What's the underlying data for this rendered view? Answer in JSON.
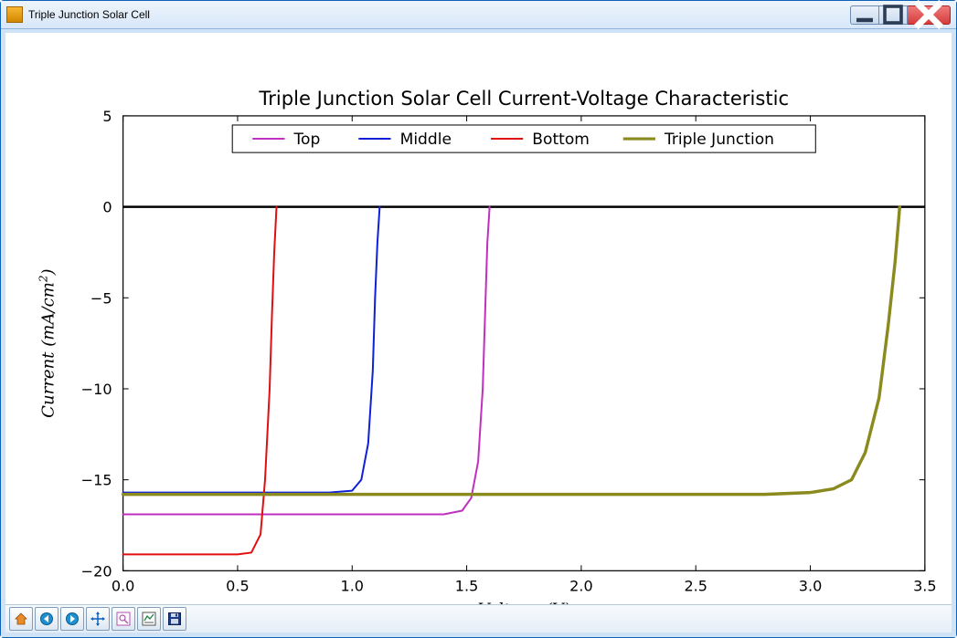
{
  "window": {
    "title": "Triple Junction Solar Cell"
  },
  "toolbar": {
    "home": "Home",
    "back": "Back",
    "forward": "Forward",
    "pan": "Pan",
    "zoom": "Zoom",
    "subplots": "Subplots",
    "save": "Save"
  },
  "chart_data": {
    "type": "line",
    "title": "Triple Junction Solar Cell Current-Voltage Characteristic",
    "xlabel": "Voltage (V)",
    "ylabel": "Current (mA/cm²)",
    "xlim": [
      0.0,
      3.5
    ],
    "ylim": [
      -20,
      5
    ],
    "xticks": [
      0.0,
      0.5,
      1.0,
      1.5,
      2.0,
      2.5,
      3.0,
      3.5
    ],
    "yticks": [
      -20,
      -15,
      -10,
      -5,
      0,
      5
    ],
    "legend_position": "top-center",
    "series": [
      {
        "name": "Top",
        "color": "#c030c0",
        "x": [
          0.0,
          0.5,
          1.0,
          1.4,
          1.48,
          1.52,
          1.55,
          1.57,
          1.58,
          1.59,
          1.6
        ],
        "y": [
          -16.9,
          -16.9,
          -16.9,
          -16.9,
          -16.7,
          -16.0,
          -14.0,
          -10.0,
          -6.0,
          -2.0,
          0.0
        ]
      },
      {
        "name": "Middle",
        "color": "#1020d8",
        "x": [
          0.0,
          0.5,
          0.9,
          1.0,
          1.04,
          1.07,
          1.09,
          1.1,
          1.11,
          1.12
        ],
        "y": [
          -15.7,
          -15.7,
          -15.7,
          -15.6,
          -15.0,
          -13.0,
          -9.0,
          -5.0,
          -2.0,
          0.0
        ]
      },
      {
        "name": "Bottom",
        "color": "#e01010",
        "x": [
          0.0,
          0.3,
          0.5,
          0.56,
          0.6,
          0.62,
          0.64,
          0.65,
          0.66,
          0.67
        ],
        "y": [
          -19.1,
          -19.1,
          -19.1,
          -19.0,
          -18.0,
          -15.0,
          -10.0,
          -6.0,
          -2.5,
          0.0
        ]
      },
      {
        "name": "Triple Junction",
        "color": "#8a8a1e",
        "x": [
          0.0,
          1.0,
          2.0,
          2.8,
          3.0,
          3.1,
          3.18,
          3.24,
          3.3,
          3.34,
          3.37,
          3.39
        ],
        "y": [
          -15.8,
          -15.8,
          -15.8,
          -15.8,
          -15.7,
          -15.5,
          -15.0,
          -13.5,
          -10.5,
          -6.5,
          -3.0,
          0.0
        ]
      }
    ]
  }
}
